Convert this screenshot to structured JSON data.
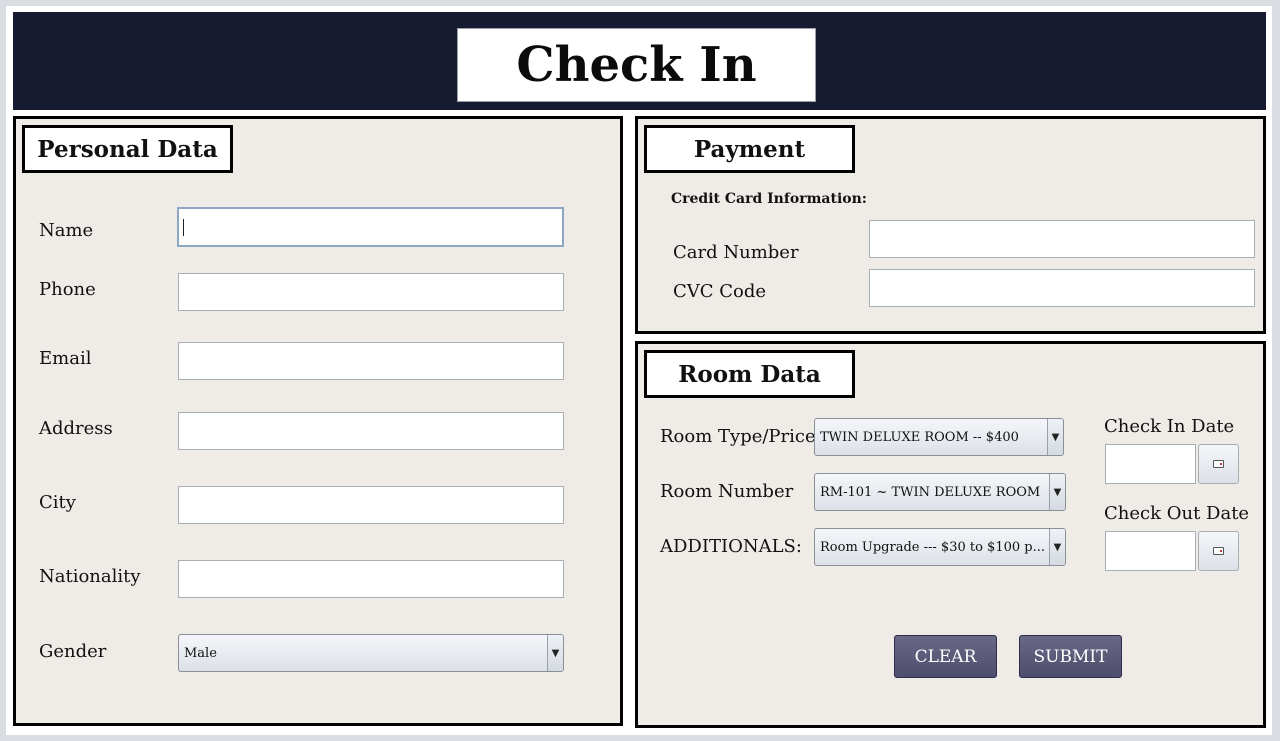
{
  "header": {
    "title": "Check In"
  },
  "personal": {
    "heading": "Personal Data",
    "name_label": "Name",
    "name_value": "",
    "phone_label": "Phone",
    "phone_value": "",
    "email_label": "Email",
    "email_value": "",
    "address_label": "Address",
    "address_value": "",
    "city_label": "City",
    "city_value": "",
    "nationality_label": "Nationality",
    "nationality_value": "",
    "gender_label": "Gender",
    "gender_value": "Male"
  },
  "payment": {
    "heading": "Payment",
    "subheading": "Credit Card Information:",
    "card_label": "Card Number",
    "card_value": "",
    "cvc_label": "CVC Code",
    "cvc_value": ""
  },
  "room": {
    "heading": "Room Data",
    "type_label": "Room Type/Price",
    "type_value": "TWIN DELUXE ROOM -- $400",
    "number_label": "Room Number",
    "number_value": "RM-101 ~ TWIN DELUXE ROOM",
    "additionals_label": "ADDITIONALS:",
    "additionals_value": "Room Upgrade --- $30 to $100 p...",
    "checkin_label": "Check In Date",
    "checkin_value": "",
    "checkout_label": "Check Out Date",
    "checkout_value": ""
  },
  "buttons": {
    "clear": "CLEAR",
    "submit": "SUBMIT"
  },
  "icons": {
    "dropdown": "chevron-down-icon",
    "calendar": "calendar-icon"
  },
  "colors": {
    "header_bg": "#171b31",
    "panel_bg": "#efebe6",
    "button_bg": "#5c5a7a"
  }
}
